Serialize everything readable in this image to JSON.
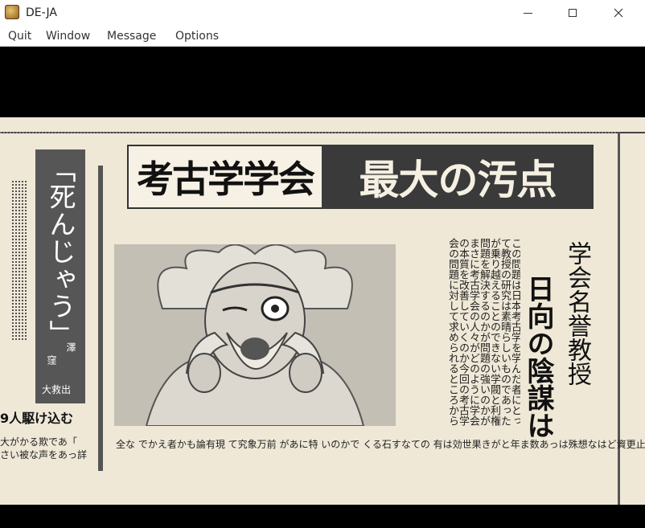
{
  "window": {
    "title": "DE-JA",
    "icon": "app-icon"
  },
  "menu": {
    "items": [
      "Quit",
      "Window",
      "Message",
      "Options"
    ]
  },
  "newspaper": {
    "headline_left": "考古学学会",
    "headline_right": "最大の汚点",
    "left_vertical": "「死んじゃう」",
    "left_sub_1": "窪",
    "left_sub_2": "澤",
    "left_sub_3": "大救出",
    "left_headline": "9人駆け込む",
    "left_body_1": "大がかる欺であ「",
    "left_body_2": "さい被な声をあっ詳",
    "sub_head_1": "学会名誉教授",
    "sub_head_2": "日向の陰謀は",
    "body_text": "この問題は日本考古学を学んだ者にとって教授の研究は素晴らしいものであったが乗り越えることのできない学閥と利権問題を解決するのかが問題の強いのかがまさに考古学会の人々がどのように学会の本質を改善していくのか今回の考古学会の問題に対して求められるところから",
    "bottom_line": "全な でかえ者かも論有現 て究象万前 があに特 いのかで くる石すなての 有は効世果きがと年ま数あっは殊想なはど資更止わ"
  }
}
